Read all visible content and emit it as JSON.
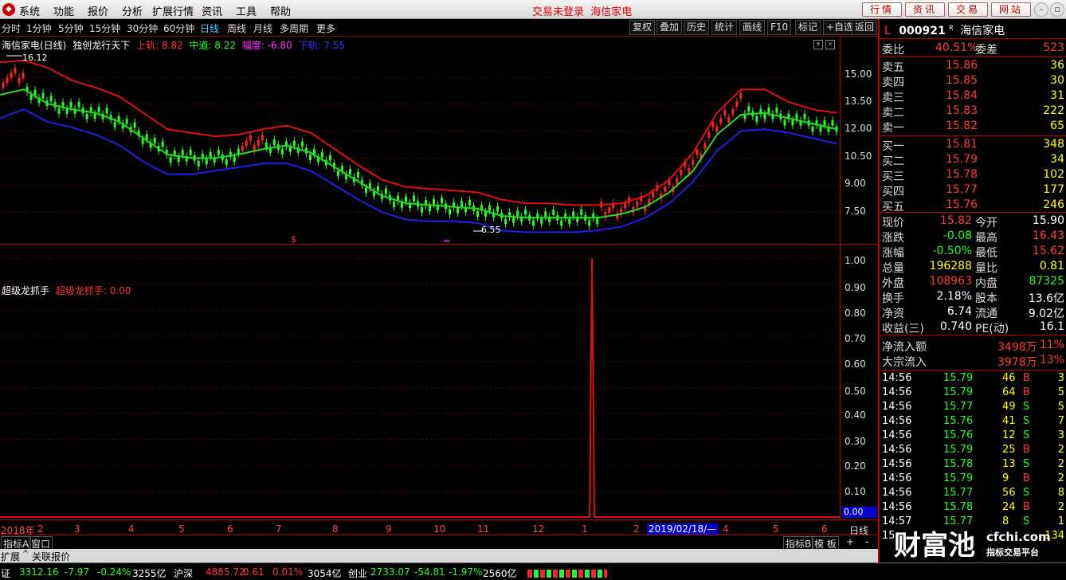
{
  "menubar": {
    "items": [
      "系统",
      "功能",
      "报价",
      "分析",
      "扩展行情",
      "资讯",
      "工具",
      "帮助"
    ],
    "status": "交易未登录",
    "stock_name": "海信家电",
    "buttons": [
      "行情",
      "资讯",
      "交易",
      "网站"
    ]
  },
  "toolbar": {
    "periods": [
      "分时",
      "1分钟",
      "5分钟",
      "15分钟",
      "30分钟",
      "60分钟",
      "日线",
      "周线",
      "月线",
      "多周期",
      "更多"
    ],
    "active": "日线",
    "right_buttons": [
      "复权",
      "叠加",
      "历史",
      "统计",
      "画线",
      "F10",
      "标记",
      "+自选",
      "返回"
    ]
  },
  "chart": {
    "title": "海信家电(日线)",
    "indicator": "独创龙行天下",
    "upper_label": "上轨: 8.82",
    "mid_label": "中道: 8.22",
    "width_label": "幅度: -6.80",
    "lower_label": "下轨: 7.55",
    "high_mark": "16.12",
    "low_mark": "6.55",
    "yticks_top": [
      "15.00",
      "13.50",
      "12.00",
      "10.50",
      "9.00",
      "7.50"
    ],
    "ind_name": "超级龙抓手",
    "ind_value": "超级龙抓手: 0.00",
    "yticks_bot": [
      "1.00",
      "0.90",
      "0.80",
      "0.70",
      "0.60",
      "0.50",
      "0.40",
      "0.30",
      "0.20",
      "0.10"
    ],
    "cur_val": "0.00",
    "xticks": [
      "2018年",
      "2",
      "3",
      "4",
      "5",
      "6",
      "7",
      "8",
      "9",
      "10",
      "11",
      "12",
      "1",
      "2",
      "2019/02/18/—",
      "4",
      "5",
      "6"
    ],
    "xright": "日线",
    "colors": {
      "upper": "#e01010",
      "mid": "#22dd22",
      "lower": "#1e1ee6",
      "spike": "#e01010"
    },
    "chart_data": {
      "type": "line",
      "series": [
        {
          "name": "上轨",
          "values": [
            15.8,
            15.9,
            15.5,
            14.8,
            14.4,
            13.9,
            13.0,
            12.1,
            11.9,
            11.7,
            11.8,
            12.1,
            12.3,
            11.9,
            11.0,
            10.1,
            9.3,
            8.9,
            8.8,
            8.7,
            8.6,
            8.2,
            8.0,
            8.0,
            7.9,
            7.9,
            8.0,
            8.4,
            9.3,
            10.8,
            13.0,
            14.3,
            14.3,
            13.6,
            13.2,
            13.0
          ]
        },
        {
          "name": "中道",
          "values": [
            14.0,
            14.3,
            13.5,
            13.2,
            13.0,
            12.5,
            11.6,
            10.7,
            10.5,
            10.5,
            10.7,
            11.0,
            11.2,
            10.8,
            10.0,
            9.2,
            8.4,
            8.0,
            7.9,
            7.8,
            7.7,
            7.3,
            7.2,
            7.2,
            7.2,
            7.2,
            7.4,
            7.8,
            8.6,
            9.8,
            11.8,
            12.9,
            13.0,
            12.7,
            12.4,
            12.1
          ]
        },
        {
          "name": "下轨",
          "values": [
            12.7,
            13.2,
            12.5,
            12.2,
            11.8,
            11.2,
            10.3,
            9.6,
            9.6,
            9.8,
            10.0,
            10.2,
            10.2,
            9.8,
            9.0,
            8.2,
            7.5,
            7.1,
            7.0,
            7.0,
            6.9,
            6.5,
            6.4,
            6.4,
            6.4,
            6.5,
            6.7,
            7.2,
            8.0,
            9.2,
            10.9,
            12.0,
            12.1,
            11.9,
            11.6,
            11.3
          ]
        }
      ],
      "ylim": [
        6.2,
        16.6
      ],
      "indicator": {
        "name": "超级龙抓手",
        "spike_index": 0.705,
        "spike_value": 1.0,
        "ylim": [
          0,
          1.05
        ]
      }
    }
  },
  "quote": {
    "code": "000921",
    "name": "海信家电",
    "flag": "L",
    "flag2": "R",
    "weibi": {
      "label": "委比",
      "value": "40.51%",
      "label2": "委差",
      "value2": "523"
    },
    "sell": [
      {
        "label": "卖五",
        "price": "15.86",
        "vol": "36"
      },
      {
        "label": "卖四",
        "price": "15.85",
        "vol": "30"
      },
      {
        "label": "卖三",
        "price": "15.84",
        "vol": "31"
      },
      {
        "label": "卖二",
        "price": "15.83",
        "vol": "222"
      },
      {
        "label": "卖一",
        "price": "15.82",
        "vol": "65"
      }
    ],
    "buy": [
      {
        "label": "买一",
        "price": "15.81",
        "vol": "348"
      },
      {
        "label": "买二",
        "price": "15.79",
        "vol": "34"
      },
      {
        "label": "买三",
        "price": "15.78",
        "vol": "102"
      },
      {
        "label": "买四",
        "price": "15.77",
        "vol": "177"
      },
      {
        "label": "买五",
        "price": "15.76",
        "vol": "246"
      }
    ],
    "stats": [
      {
        "l1": "现价",
        "v1": "15.82",
        "l2": "今开",
        "v2": "15.90"
      },
      {
        "l1": "涨跌",
        "v1": "-0.08",
        "l2": "最高",
        "v2": "16.43"
      },
      {
        "l1": "涨幅",
        "v1": "-0.50%",
        "l2": "最低",
        "v2": "15.62"
      },
      {
        "l1": "总量",
        "v1": "196288",
        "l2": "量比",
        "v2": "0.81"
      },
      {
        "l1": "外盘",
        "v1": "108963",
        "l2": "内盘",
        "v2": "87325"
      },
      {
        "l1": "换手",
        "v1": "2.18%",
        "l2": "股本",
        "v2": "13.6亿"
      },
      {
        "l1": "净资",
        "v1": "6.74",
        "l2": "流通",
        "v2": "9.02亿"
      },
      {
        "l1": "收益(三)",
        "v1": "0.740",
        "l2": "PE(动)",
        "v2": "16.1"
      }
    ],
    "flows": [
      {
        "label": "净流入额",
        "value": "3498万",
        "pct": "11%"
      },
      {
        "label": "大宗流入",
        "value": "3978万",
        "pct": "13%"
      }
    ],
    "ticks": [
      {
        "t": "14:56",
        "p": "15.79",
        "v": "46",
        "s": "B",
        "n": "3"
      },
      {
        "t": "14:56",
        "p": "15.79",
        "v": "64",
        "s": "B",
        "n": "5"
      },
      {
        "t": "14:56",
        "p": "15.77",
        "v": "49",
        "s": "S",
        "n": "5"
      },
      {
        "t": "14:56",
        "p": "15.76",
        "v": "41",
        "s": "S",
        "n": "7"
      },
      {
        "t": "14:56",
        "p": "15.76",
        "v": "12",
        "s": "S",
        "n": "3"
      },
      {
        "t": "14:56",
        "p": "15.79",
        "v": "25",
        "s": "B",
        "n": "2"
      },
      {
        "t": "14:56",
        "p": "15.78",
        "v": "13",
        "s": "S",
        "n": "2"
      },
      {
        "t": "14:56",
        "p": "15.79",
        "v": "9",
        "s": "B",
        "n": "2"
      },
      {
        "t": "14:56",
        "p": "15.77",
        "v": "56",
        "s": "S",
        "n": "8"
      },
      {
        "t": "14:56",
        "p": "15.78",
        "v": "24",
        "s": "B",
        "n": "2"
      },
      {
        "t": "14:57",
        "p": "15.77",
        "v": "8",
        "s": "S",
        "n": "1"
      },
      {
        "t": "15",
        "p": "",
        "v": "",
        "s": "",
        "n": "134"
      }
    ]
  },
  "bottom": {
    "tab1": "指标A",
    "tab2": "窗口",
    "tab3": "指标B",
    "tab4": "模 板",
    "ext": "扩展",
    "ext2": "关联报价"
  },
  "status": [
    {
      "name": "证",
      "v": "3312.16",
      "c": "-7.97",
      "p": "-0.24%",
      "a": "3255亿"
    },
    {
      "name": "沪深",
      "v": "4885.72",
      "c": "0.61",
      "p": "0.01%",
      "a": "3054亿"
    },
    {
      "name": "创业",
      "v": "2733.07",
      "c": "-54.81",
      "p": "-1.97%",
      "a": "2560亿"
    }
  ],
  "watermark": {
    "big": "财富池",
    "url": "cfchi.com",
    "sub": "指标交易平台"
  }
}
